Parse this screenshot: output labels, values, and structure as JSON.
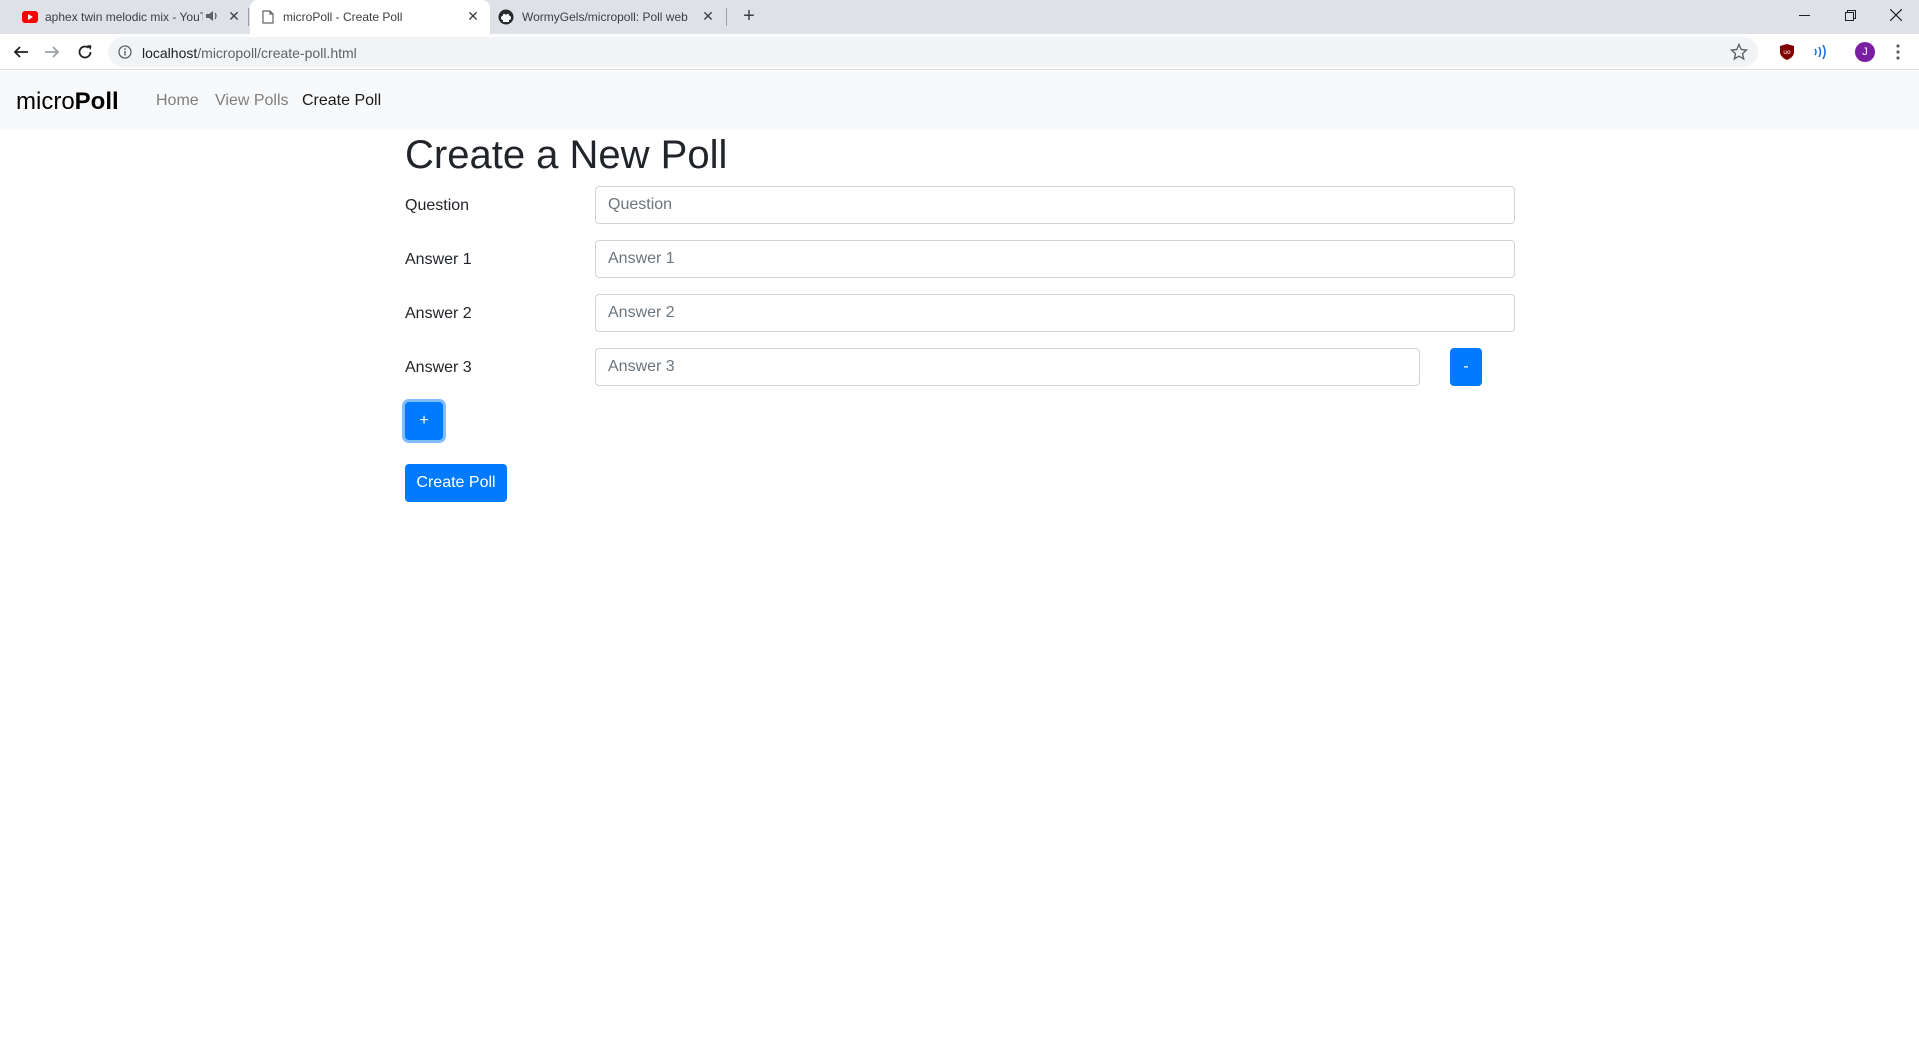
{
  "browser": {
    "tabs": [
      {
        "title": "aphex twin melodic mix - YouTube",
        "favicon": "youtube-icon",
        "audible": true,
        "active": false
      },
      {
        "title": "microPoll - Create Poll",
        "favicon": "page-icon",
        "audible": false,
        "active": true
      },
      {
        "title": "WormyGels/micropoll: Poll website",
        "favicon": "github-icon",
        "audible": false,
        "active": false
      }
    ],
    "new_tab_label": "+",
    "url_host": "localhost",
    "url_path": "/micropoll/create-poll.html",
    "avatar_letter": "J",
    "colors": {
      "tabbar": "#dee1e6",
      "omnibox": "#f1f3f4",
      "avatar": "#7b1fa2",
      "youtube": "#ff0000"
    }
  },
  "navbar": {
    "brand_light": "micro",
    "brand_bold": "Poll",
    "links": [
      {
        "label": "Home",
        "active": false
      },
      {
        "label": "View Polls",
        "active": false
      },
      {
        "label": "Create Poll",
        "active": true
      }
    ]
  },
  "form": {
    "title": "Create a New Poll",
    "question": {
      "label": "Question",
      "placeholder": "Question",
      "value": ""
    },
    "answers": [
      {
        "label": "Answer 1",
        "placeholder": "Answer 1",
        "value": ""
      },
      {
        "label": "Answer 2",
        "placeholder": "Answer 2",
        "value": ""
      },
      {
        "label": "Answer 3",
        "placeholder": "Answer 3",
        "value": ""
      }
    ],
    "remove_button_label": "-",
    "add_button_label": "+",
    "submit_label": "Create Poll"
  },
  "colors": {
    "primary": "#007bff",
    "navbar_bg": "#f8f9fa",
    "text": "#212529"
  }
}
